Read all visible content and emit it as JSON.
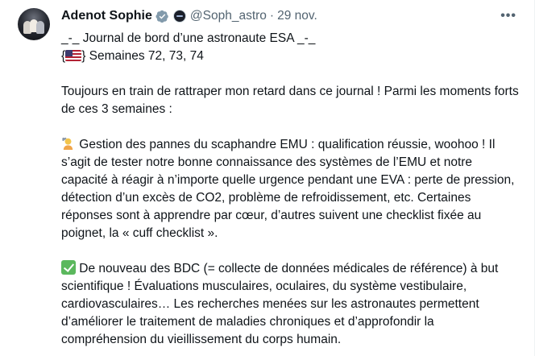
{
  "author": {
    "name": "Adenot Sophie",
    "handle": "@Soph_astro",
    "separator": "·",
    "date": "29 nov.",
    "verified_icon": "verified-badge-icon",
    "affiliation_icon": "esa-affiliation-badge-icon"
  },
  "menu": {
    "more_label": "•••"
  },
  "body": {
    "title_line": "_-_ Journal de bord d’une astronaute ESA _-_",
    "weeks_open": "{",
    "weeks_flag_icon": "us-flag-emoji",
    "weeks_text": "} Semaines 72, 73, 74",
    "intro": "Toujours en train de rattraper mon retard dans ce journal ! Parmi les moments forts de ces 3 semaines :",
    "item1_icon": "mechanic-emoji",
    "item1_text": " Gestion des pannes du scaphandre EMU : qualification réussie, woohoo ! Il s’agit de tester notre bonne connaissance des systèmes de l’EMU et notre capacité à réagir à n’importe quelle urgence pendant une EVA : perte de pression, détection d’un excès de CO2, problème de refroidissement, etc. Certaines réponses sont à apprendre par cœur, d’autres suivent une checklist fixée au poignet, la « cuff checklist ».",
    "item2_icon": "check-mark-emoji",
    "item2_text": " De nouveau des BDC (= collecte de données médicales de référence) à but scientifique ! Évaluations musculaires, oculaires, du système vestibulaire, cardiovasculaires… Les recherches menées sur les astronautes permettent d’améliorer le traitement de maladies chroniques et d’approfondir la compréhension du vieillissement du corps humain."
  },
  "colors": {
    "text": "#0f1419",
    "secondary": "#536471",
    "verified": "#829aab",
    "check": "#5bb85d"
  }
}
